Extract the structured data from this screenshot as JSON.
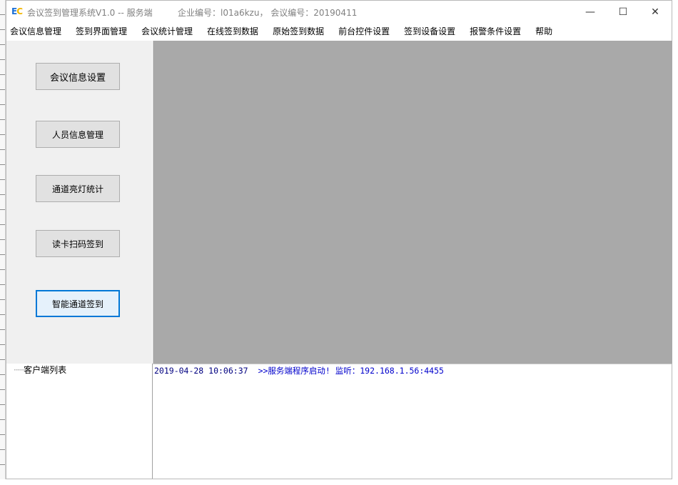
{
  "window": {
    "title": "会议签到管理系统V1.0 -- 服务端",
    "info": "企业编号：l01a6kzu， 会议编号：20190411",
    "icon_letters": [
      "E",
      "C"
    ],
    "controls": {
      "minimize": "—",
      "maximize": "☐",
      "close": "✕"
    }
  },
  "menu": [
    "会议信息管理",
    "签到界面管理",
    "会议统计管理",
    "在线签到数据",
    "原始签到数据",
    "前台控件设置",
    "签到设备设置",
    "报警条件设置",
    "帮助"
  ],
  "sidebar": {
    "buttons": [
      "会议信息设置",
      "人员信息管理",
      "通道亮灯统计",
      "读卡扫码签到",
      "智能通道签到"
    ]
  },
  "tree": {
    "root_label": "客户端列表"
  },
  "log": [
    {
      "time": "2019-04-28 10:06:37",
      "message": ">>服务端程序启动! 监听：192.168.1.56:4455"
    }
  ],
  "colors": {
    "accent": "#0078d7",
    "main_bg": "#a9a9a9",
    "log_text": "#0000cc",
    "icon_e": "#1a6fd6",
    "icon_c": "#f2b600"
  }
}
